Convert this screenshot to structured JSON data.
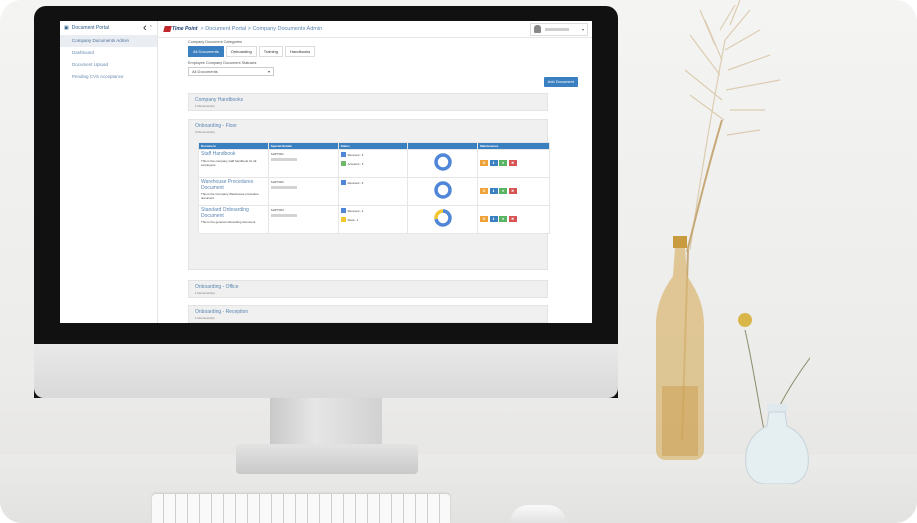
{
  "app": {
    "logo_text": "Time Point",
    "breadcrumb": "> Document Portal > Company Documents Admin"
  },
  "sidebar": {
    "header": "Document Portal",
    "items": [
      {
        "label": "Company Documents Admin",
        "active": true
      },
      {
        "label": "Dashboard",
        "active": false
      },
      {
        "label": "Document Upload",
        "active": false
      },
      {
        "label": "Pending CVS Acceptance",
        "active": false
      }
    ]
  },
  "filters": {
    "category_label": "Company Document Categories",
    "tabs": [
      {
        "label": "All Documents",
        "active": true
      },
      {
        "label": "Onboarding",
        "active": false
      },
      {
        "label": "Training",
        "active": false
      },
      {
        "label": "Handbooks",
        "active": false
      }
    ],
    "status_label": "Employee Company Document Statuses",
    "status_value": "All Documents",
    "add_button": "Add Document"
  },
  "sections": [
    {
      "title": "Company Handbooks",
      "count": "1 Document(s)"
    },
    {
      "title": "Onboarding - Floor",
      "count": "3 Document(s)"
    },
    {
      "title": "Onboarding - Office",
      "count": "1 Document(s)"
    },
    {
      "title": "Onboarding - Reception",
      "count": "1 Document(s)"
    }
  ],
  "table": {
    "headers": [
      "Document",
      "Special Details",
      "Status",
      "",
      "Maintenance"
    ],
    "rows": [
      {
        "name": "Staff Handbook",
        "desc": "This is the company staff handbook for all employees",
        "detail": "SHPT001",
        "statuses": [
          {
            "label": "Received - 5",
            "color": "#4f86d8"
          },
          {
            "label": "Accepted - 5",
            "color": "#6fb86a"
          }
        ],
        "donut": {
          "segments": [
            {
              "value": 1,
              "color": "#4f86d8"
            }
          ]
        }
      },
      {
        "name": "Warehouse Procedures Document",
        "desc": "This is the Company Warehouse procedure document",
        "detail": "SHPT002",
        "statuses": [
          {
            "label": "Received - 6",
            "color": "#4f86d8"
          }
        ],
        "donut": {
          "segments": [
            {
              "value": 1,
              "color": "#4f86d8"
            }
          ]
        }
      },
      {
        "name": "Standard Onboarding Document",
        "desc": "This is the general onboarding document",
        "detail": "SHPT003",
        "statuses": [
          {
            "label": "Received - 3",
            "color": "#4f86d8"
          },
          {
            "label": "Read - 1",
            "color": "#f2c531"
          }
        ],
        "donut": {
          "segments": [
            {
              "value": 0.72,
              "color": "#4f86d8"
            },
            {
              "value": 0.28,
              "color": "#f2c531"
            }
          ]
        }
      }
    ]
  },
  "maintenance_icons": [
    "gear-icon",
    "download-icon",
    "star-icon",
    "trash-icon"
  ]
}
